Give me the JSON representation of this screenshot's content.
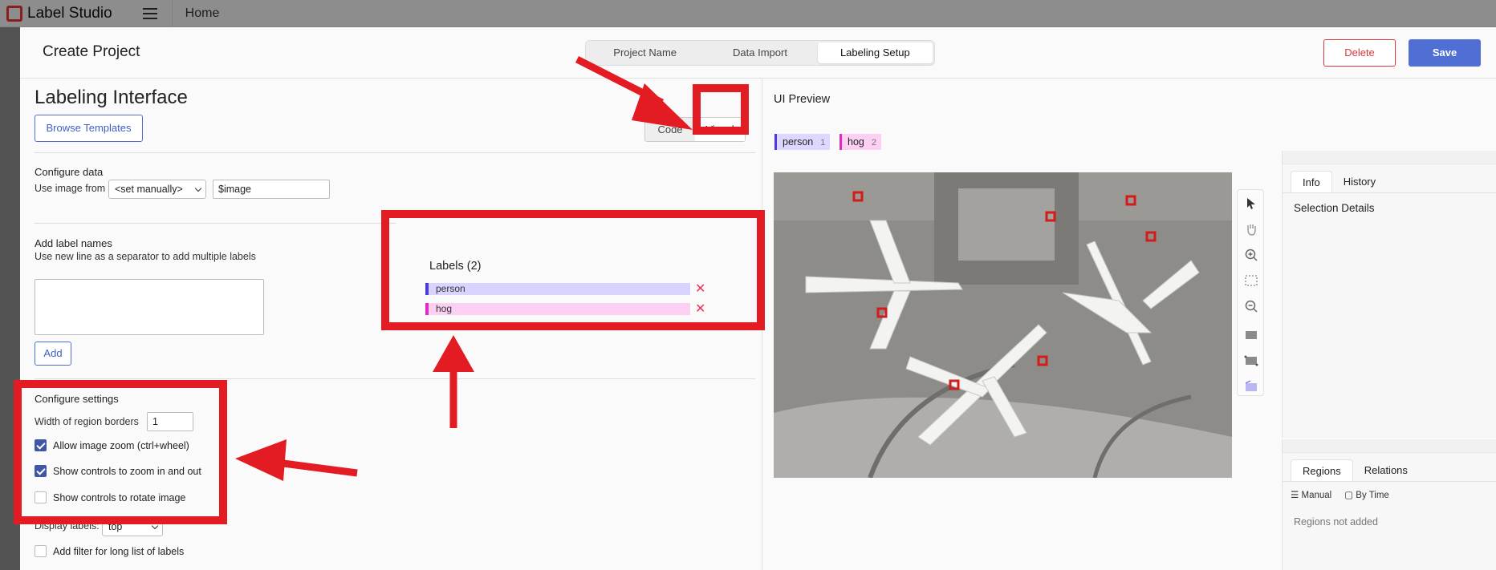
{
  "app": {
    "name": "Label Studio",
    "breadcrumb": "Home"
  },
  "modal": {
    "title": "Create Project",
    "steps": [
      "Project Name",
      "Data Import",
      "Labeling Setup"
    ],
    "active_step": "Labeling Setup",
    "delete_label": "Delete",
    "save_label": "Save"
  },
  "config": {
    "heading": "Labeling Interface",
    "browse_label": "Browse Templates",
    "view_tabs": [
      "Code",
      "Visual"
    ],
    "active_view": "Visual",
    "configure_data": {
      "title": "Configure data",
      "use_image_from": "Use image from",
      "source_select": "<set manually>",
      "source_value": "$image"
    },
    "add_labels": {
      "title": "Add label names",
      "hint": "Use new line as a separator to add multiple labels",
      "add_label": "Add"
    },
    "labels_panel": {
      "title": "Labels (2)",
      "items": [
        {
          "name": "person",
          "color": "#4a3be0",
          "bg": "#d9d4ff"
        },
        {
          "name": "hog",
          "color": "#e02bc1",
          "bg": "#fbd0f2"
        }
      ],
      "remove_glyph": "✕"
    },
    "settings": {
      "title": "Configure settings",
      "region_border_label": "Width of region borders",
      "region_border_value": "1",
      "options": [
        {
          "label": "Allow image zoom (ctrl+wheel)",
          "checked": true
        },
        {
          "label": "Show controls to zoom in and out",
          "checked": true
        },
        {
          "label": "Show controls to rotate image",
          "checked": false
        }
      ],
      "display_labels_label": "Display labels:",
      "display_labels_value": "top",
      "filter_label": "Add filter for long list of labels",
      "filter_checked": false
    }
  },
  "preview": {
    "title": "UI Preview",
    "chips": [
      {
        "name": "person",
        "hotkey": "1",
        "color": "#4a3be0",
        "bg": "#dcd8ff"
      },
      {
        "name": "hog",
        "hotkey": "2",
        "color": "#e02bc1",
        "bg": "#fbd0f2"
      }
    ],
    "info_tabs": [
      "Info",
      "History"
    ],
    "info_active": "Info",
    "selection_title": "Selection Details",
    "region_tabs": [
      "Regions",
      "Relations"
    ],
    "region_active": "Regions",
    "sort_manual": "Manual",
    "sort_by_time": "By Time",
    "empty_regions": "Regions not added"
  },
  "annotation_color": "#e31b23"
}
